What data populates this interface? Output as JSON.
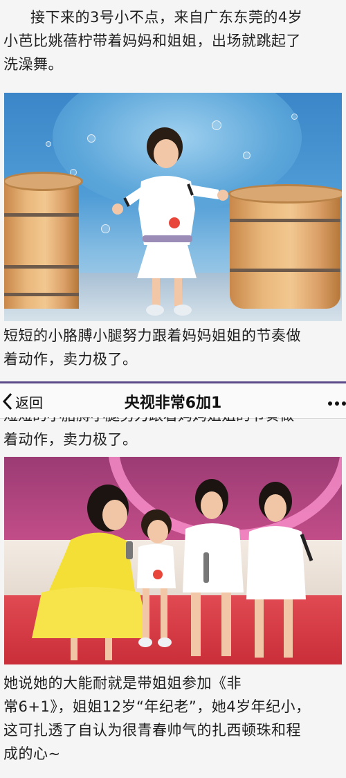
{
  "article": {
    "p1": {
      "line1": "接下来的3号小不点，来自广东东莞的4岁",
      "line2": "小芭比姚蓓柠带着妈妈和姐姐，出场就跳起了",
      "line3": "洗澡舞。"
    },
    "p2": {
      "line1": "短短的小胳膊小腿努力跟着妈妈姐姐的节奏做",
      "line2": "着动作，卖力极了。"
    },
    "p3": {
      "line1": "着动作，卖力极了。"
    },
    "p4": {
      "line1": "她说她的大能耐就是带姐姐参加《非",
      "line2": "常6+1》，姐姐12岁“年纪老”，她4岁年纪小，",
      "line3": "这可扎透了自认为很青春帅气的扎西顿珠和程",
      "line4": "成的心~"
    }
  },
  "appbar": {
    "back_label": "返回",
    "title": "央视非常6加1",
    "back_icon": "chevron-left-icon",
    "more_icon": "more-dots-icon"
  },
  "colors": {
    "appbar_accent": "#5a4a8a",
    "stage_blue": "#4f9cd6",
    "studio_pink": "#c24d88",
    "couch_red": "#c92e39"
  }
}
